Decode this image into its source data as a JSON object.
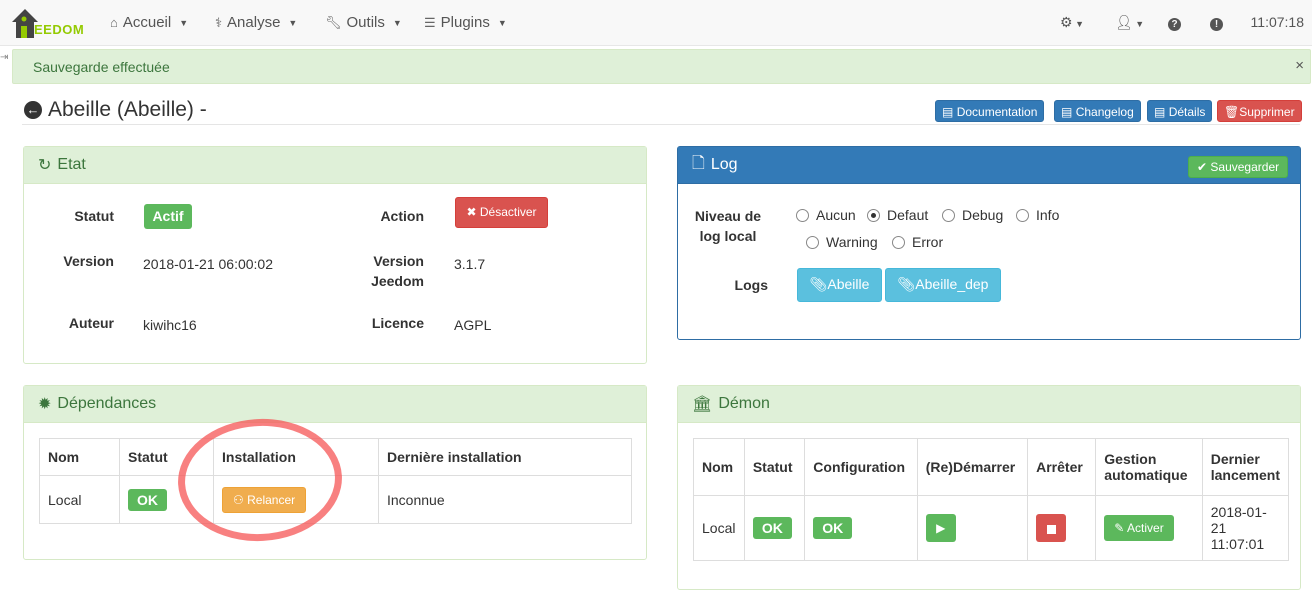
{
  "navbar": {
    "logo_text": "EEDOM",
    "items": [
      {
        "label": "Accueil",
        "icon": "home-icon"
      },
      {
        "label": "Analyse",
        "icon": "stethoscope-icon"
      },
      {
        "label": "Outils",
        "icon": "wrench-icon"
      },
      {
        "label": "Plugins",
        "icon": "tasks-icon"
      }
    ],
    "clock": "11:07:18"
  },
  "alert": {
    "message": "Sauvegarde effectuée",
    "close": "×"
  },
  "page": {
    "title": "Abeille (Abeille) -",
    "buttons": {
      "documentation": "Documentation",
      "changelog": "Changelog",
      "details": "Détails",
      "delete": "Supprimer"
    }
  },
  "etat": {
    "title": "Etat",
    "statut_label": "Statut",
    "statut_value": "Actif",
    "action_label": "Action",
    "action_button": "Désactiver",
    "version_label": "Version",
    "version_value": "2018-01-21 06:00:02",
    "jeedom_version_label_1": "Version",
    "jeedom_version_label_2": "Jeedom",
    "jeedom_version_value": "3.1.7",
    "auteur_label": "Auteur",
    "auteur_value": "kiwihc16",
    "licence_label": "Licence",
    "licence_value": "AGPL"
  },
  "log": {
    "title": "Log",
    "save_button": "Sauvegarder",
    "level_label_1": "Niveau de",
    "level_label_2": "log local",
    "levels": [
      "Aucun",
      "Defaut",
      "Debug",
      "Info",
      "Warning",
      "Error"
    ],
    "selected_level": "Defaut",
    "logs_label": "Logs",
    "log_buttons": [
      "Abeille",
      "Abeille_dep"
    ]
  },
  "dependances": {
    "title": "Dépendances",
    "headers": [
      "Nom",
      "Statut",
      "Installation",
      "Dernière installation"
    ],
    "row": {
      "nom": "Local",
      "statut": "OK",
      "installation": "Relancer",
      "derniere": "Inconnue"
    }
  },
  "demon": {
    "title": "Démon",
    "headers": {
      "nom": "Nom",
      "statut": "Statut",
      "configuration": "Configuration",
      "redemarrer": "(Re)Démarrer",
      "arreter": "Arrêter",
      "gestion_1": "Gestion",
      "gestion_2": "automatique",
      "dernier_1": "Dernier",
      "dernier_2": "lancement"
    },
    "row": {
      "nom": "Local",
      "statut": "OK",
      "configuration": "OK",
      "gestion": "Activer",
      "dernier_1": "2018-01-21",
      "dernier_2": "11:07:01"
    }
  },
  "colors": {
    "success": "#5cb85c",
    "danger": "#d9534f",
    "primary": "#337ab7",
    "info": "#5bc0de",
    "warning": "#f0ad4e",
    "annotation": "#f55555"
  }
}
